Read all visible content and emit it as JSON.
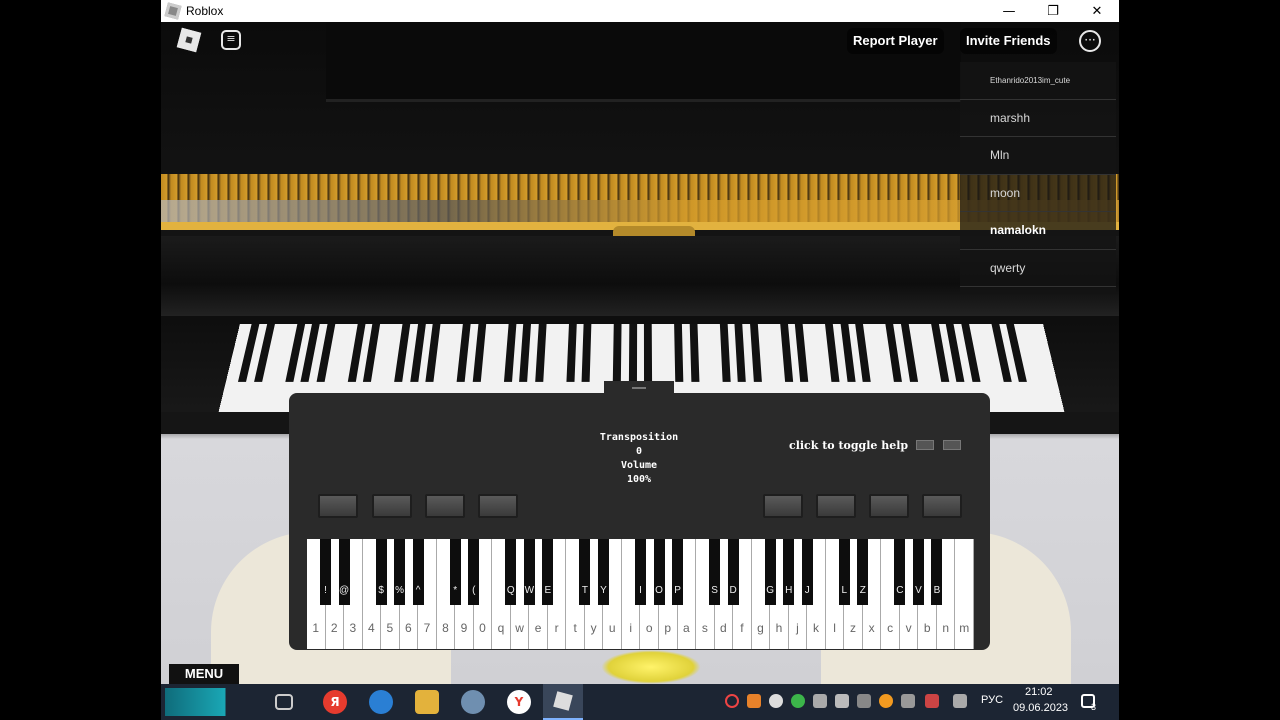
{
  "window": {
    "title": "Roblox",
    "minimize": "—",
    "maximize": "❐",
    "close": "✕"
  },
  "top_bar": {
    "report_player": "Report Player",
    "invite_friends": "Invite Friends",
    "more": "···"
  },
  "players": [
    "Ethanrido2013im_cute",
    "marshh",
    "Mln",
    "moon",
    "namalokn",
    "qwerty"
  ],
  "keyboard_panel": {
    "transposition_label": "Transposition",
    "transposition_value": "0",
    "volume_label": "Volume",
    "volume_value": "100%",
    "help_text": "click to toggle help",
    "help_arrow": ">",
    "white_keys": [
      "1",
      "2",
      "3",
      "4",
      "5",
      "6",
      "7",
      "8",
      "9",
      "0",
      "q",
      "w",
      "e",
      "r",
      "t",
      "y",
      "u",
      "i",
      "o",
      "p",
      "a",
      "s",
      "d",
      "f",
      "g",
      "h",
      "j",
      "k",
      "l",
      "z",
      "x",
      "c",
      "v",
      "b",
      "n",
      "m"
    ],
    "black_keys": [
      "!",
      "@",
      "$",
      "%",
      "^",
      "*",
      "(",
      "Q",
      "W",
      "E",
      "T",
      "Y",
      "I",
      "O",
      "P",
      "S",
      "D",
      "G",
      "H",
      "J",
      "L",
      "Z",
      "C",
      "V",
      "B"
    ]
  },
  "menu_label": "MENU",
  "taskbar": {
    "language": "РУС",
    "time": "21:02",
    "date": "09.06.2023",
    "notifications": "3",
    "yandex_label": "Я",
    "yandex_browser_label": "Y"
  }
}
